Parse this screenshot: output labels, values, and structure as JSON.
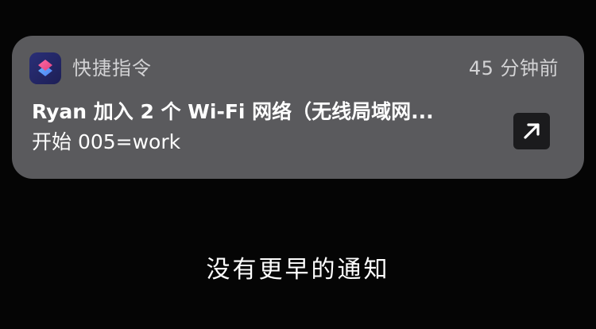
{
  "notification": {
    "app_icon": "shortcuts-app-icon",
    "app_name": "快捷指令",
    "timestamp": "45 分钟前",
    "title": "Ryan 加入 2 个 Wi-Fi 网络（无线局域网...",
    "body": "开始 005=work",
    "open_icon": "arrow-up-right-icon"
  },
  "empty_state": {
    "message": "没有更早的通知"
  },
  "colors": {
    "background": "#050505",
    "card": "#5a5a5d",
    "secondary_text": "#d2d2d4",
    "primary_text": "#ffffff",
    "shortcuts_pink": "#f04e8a",
    "shortcuts_blue": "#4f7df3"
  }
}
